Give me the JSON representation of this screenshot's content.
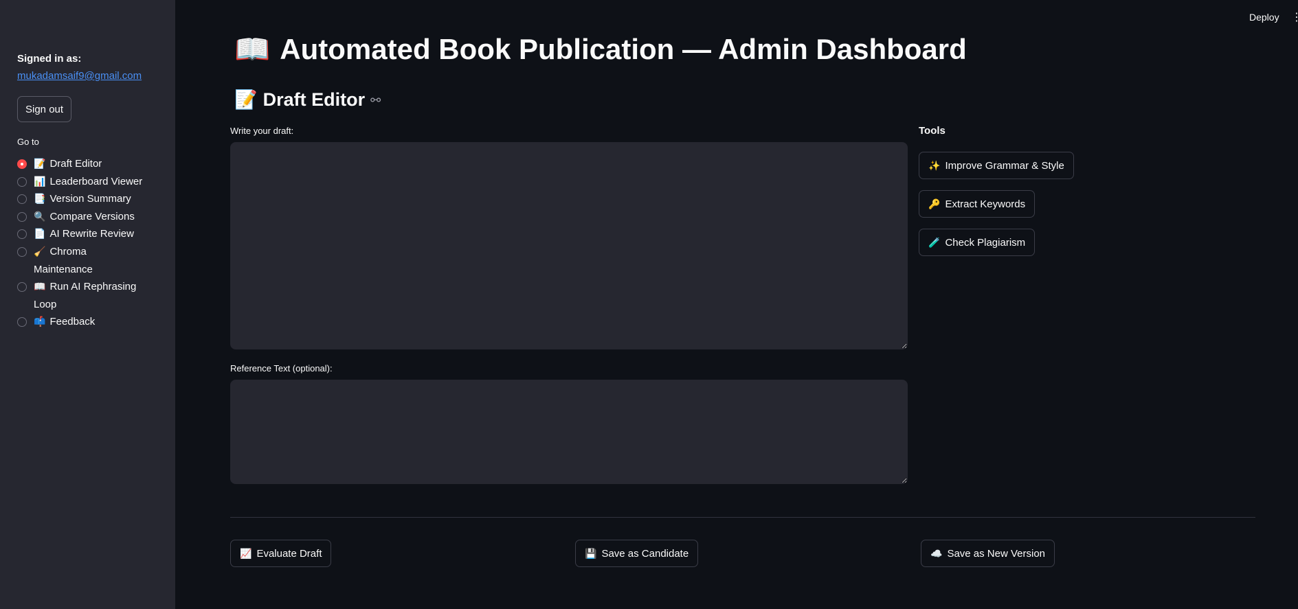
{
  "header": {
    "deploy_label": "Deploy",
    "menu_icon": "⋮"
  },
  "sidebar": {
    "signed_in_label": "Signed in as:",
    "user_email": "mukadamsaif9@gmail.com",
    "sign_out_label": "Sign out",
    "goto_label": "Go to",
    "items": [
      {
        "emoji": "📝",
        "label": "Draft Editor",
        "selected": true
      },
      {
        "emoji": "📊",
        "label": "Leaderboard Viewer",
        "selected": false
      },
      {
        "emoji": "📑",
        "label": "Version Summary",
        "selected": false
      },
      {
        "emoji": "🔍",
        "label": "Compare Versions",
        "selected": false
      },
      {
        "emoji": "📄",
        "label": "AI Rewrite Review",
        "selected": false
      },
      {
        "emoji": "🧹",
        "label": "Chroma Maintenance",
        "selected": false
      },
      {
        "emoji": "📖",
        "label": "Run AI Rephrasing Loop",
        "selected": false
      },
      {
        "emoji": "📫",
        "label": "Feedback",
        "selected": false
      }
    ],
    "accent_color": "#ff4b4b"
  },
  "main": {
    "title_emoji": "📖",
    "title": "Automated Book Publication — Admin Dashboard",
    "section_emoji": "📝",
    "section_title": "Draft Editor",
    "draft_label": "Write your draft:",
    "draft_value": "",
    "reference_label": "Reference Text (optional):",
    "reference_value": "",
    "tools_title": "Tools",
    "tools": {
      "grammar_emoji": "✨",
      "grammar_label": "Improve Grammar & Style",
      "keywords_emoji": "🔑",
      "keywords_label": "Extract Keywords",
      "plagiarism_emoji": "🧪",
      "plagiarism_label": "Check Plagiarism"
    },
    "actions": {
      "evaluate_emoji": "📈",
      "evaluate_label": "Evaluate Draft",
      "candidate_emoji": "💾",
      "candidate_label": "Save as Candidate",
      "version_emoji": "☁️",
      "version_label": "Save as New Version"
    }
  },
  "colors": {
    "background": "#0e1117",
    "sidebar": "#262730",
    "link": "#4a90f5"
  }
}
